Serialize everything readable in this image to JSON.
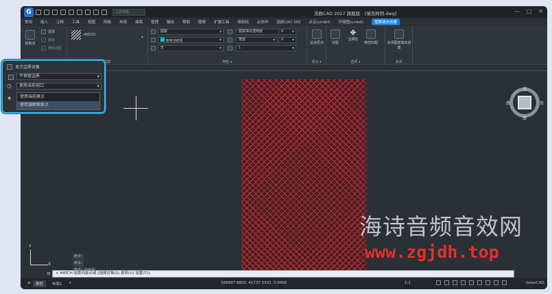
{
  "titlebar": {
    "logo": "G",
    "search_placeholder": "工具搜索",
    "doc_title": "浩辰CAD 2027 旗舰版 - [填充样例.dwg]",
    "win_min": "—",
    "win_max": "□",
    "win_close": "✕"
  },
  "menu": {
    "items": [
      "常用",
      "插入",
      "注释",
      "工具",
      "视图",
      "网格",
      "布局",
      "曲面",
      "管理",
      "输出",
      "帮助",
      "图纸",
      "扩展工具",
      "授权码",
      "云协作",
      "浩辰CAD 365",
      "点云(undef)",
      "平面图(undef)",
      "图案填充创建"
    ],
    "active_index": 18
  },
  "ribbon": {
    "boundary": {
      "pick_label": "拾取点",
      "select_label": "选择",
      "remove_label": "删除",
      "recreate_label": "重新创建"
    },
    "pattern": {
      "name": "ANSI31",
      "label": "图案"
    },
    "props": {
      "type_value": "图案",
      "color_value": "使用当前项",
      "bg_value": "无",
      "transparency_label": "图案填充透明度",
      "transparency_value": "0",
      "angle_label": "角度",
      "angle_value": "0",
      "scale_value": "1",
      "label": "特性 ▾"
    },
    "origin": {
      "btn": "设定原点",
      "label": "原点 ▾"
    },
    "options": {
      "assoc": "关联",
      "annot": "注释性",
      "match": "特性匹配",
      "label": "选项 ▾"
    },
    "close": {
      "btn": "关闭图案填充创建",
      "label": "关闭"
    }
  },
  "viewcube": {
    "n": "北",
    "s": "南",
    "w": "西",
    "e": "东"
  },
  "ucs": {
    "y": "Y",
    "x": "X"
  },
  "history": [
    "命令:",
    "命令:",
    "命令: _hatch"
  ],
  "cmdline": {
    "text": "× HATCH 拾取内部点或 [选择对象(S) 放弃(U) 设置(T)]:",
    "icons": [
      "≡",
      "✕",
      "⚙"
    ]
  },
  "status": {
    "tabs": [
      "模型",
      "布局1",
      "+"
    ],
    "coords": "168997.6803, 41737.3332, 0.0000",
    "scale": "1:1",
    "brand": "GstarCAD"
  },
  "popup": {
    "title": "显示边界对象",
    "dd1": "不保留边界",
    "dd2": "使用当前视口",
    "options": [
      "使用当前原点",
      "使用源图案原点"
    ],
    "selected_index": 1,
    "side_icons": [
      "⊡",
      "◷",
      "★"
    ]
  },
  "watermark": {
    "line1": "海诗音频音效网",
    "line2": "www.zgjdh.top"
  }
}
